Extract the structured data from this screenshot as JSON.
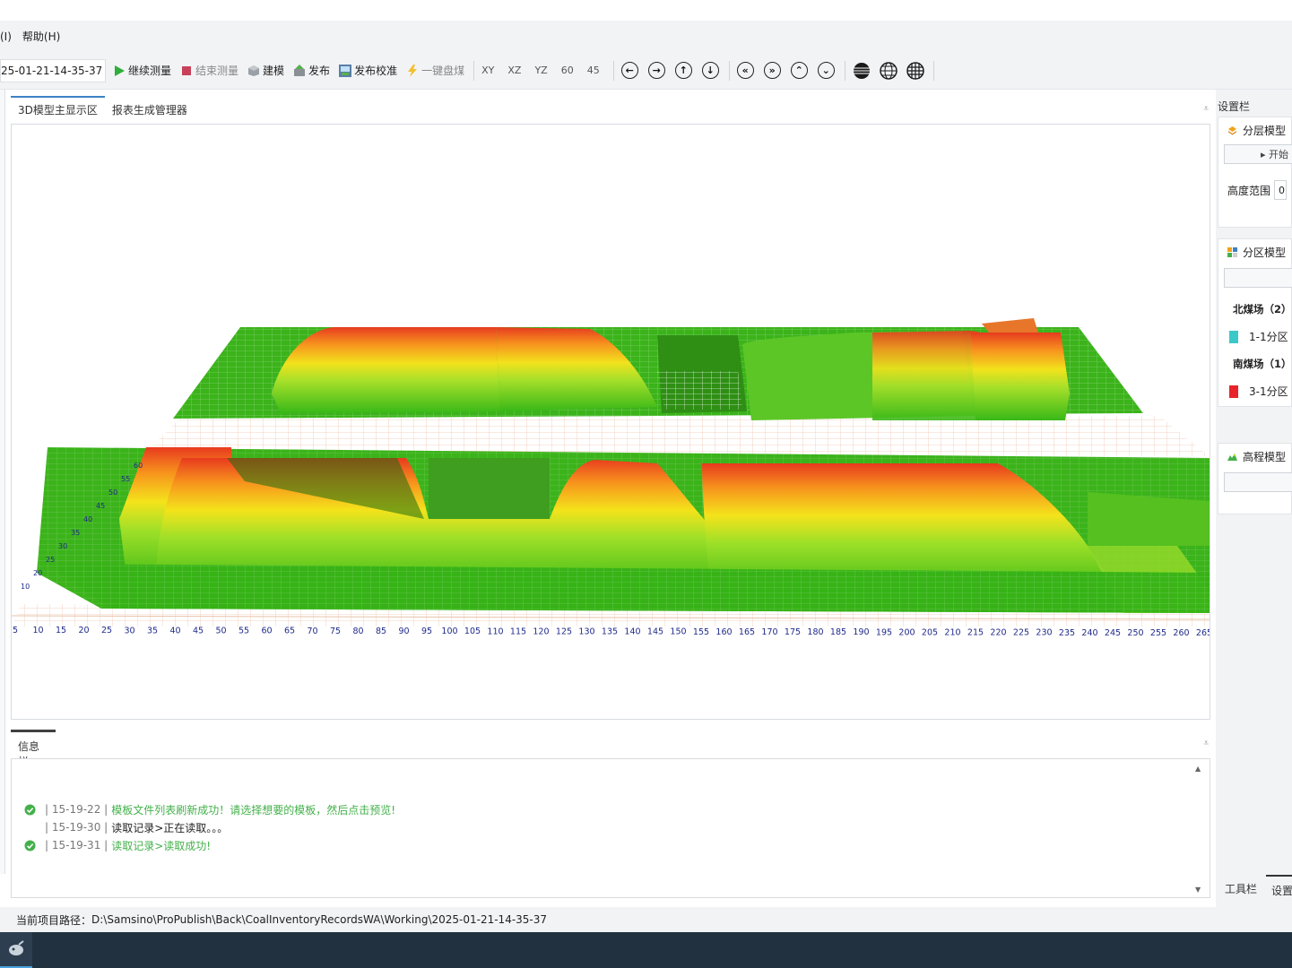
{
  "menu": {
    "items": [
      "(I)",
      "帮助(H)"
    ]
  },
  "toolbar": {
    "date_value": "25-01-21-14-35-37",
    "buttons": [
      {
        "label": "继续测量",
        "icon": "play-icon"
      },
      {
        "label": "结束测量",
        "icon": "stop-icon"
      },
      {
        "label": "建模",
        "icon": "cube-icon"
      },
      {
        "label": "发布",
        "icon": "publish-icon"
      },
      {
        "label": "发布校准",
        "icon": "publish-calibrate-icon"
      },
      {
        "label": "一键盘煤",
        "icon": "lightning-icon"
      }
    ],
    "views": [
      "XY",
      "XZ",
      "YZ",
      "60",
      "45"
    ],
    "nav_icons": [
      "arrow-left-icon",
      "arrow-right-icon",
      "arrow-up-icon",
      "arrow-down-icon",
      "double-left-icon",
      "double-right-icon",
      "double-up-icon",
      "double-down-icon"
    ],
    "render_icons": [
      "solid-globe-icon",
      "wire-globe-icon",
      "grid-globe-icon"
    ]
  },
  "main_tabs": [
    "3D模型主显示区",
    "报表生成管理器"
  ],
  "viewport": {
    "axis_ticks": [
      "5",
      "10",
      "15",
      "20",
      "25",
      "30",
      "35",
      "40",
      "45",
      "50",
      "55",
      "60",
      "65",
      "70",
      "75",
      "80",
      "85",
      "90",
      "95",
      "100",
      "105",
      "110",
      "115",
      "120",
      "125",
      "130",
      "135",
      "140",
      "145",
      "150",
      "155",
      "160",
      "165",
      "170",
      "175",
      "180",
      "185",
      "190",
      "195",
      "200",
      "205",
      "210",
      "215",
      "220",
      "225",
      "230",
      "235",
      "240",
      "245",
      "250",
      "255",
      "260",
      "265"
    ],
    "left_ticks": [
      "10",
      "20",
      "25",
      "30",
      "35",
      "40",
      "45",
      "50",
      "55",
      "60"
    ]
  },
  "info": {
    "tab_label": "信息栏",
    "logs": [
      {
        "time": "| 15-19-22 |",
        "msg": "模板文件列表刷新成功！请选择想要的模板，然后点击预览!",
        "status": "ok"
      },
      {
        "time": "| 15-19-30 |",
        "msg": "读取记录>正在读取。。。",
        "status": "plain"
      },
      {
        "time": "| 15-19-31 |",
        "msg": "读取记录>读取成功!",
        "status": "ok"
      }
    ]
  },
  "settings": {
    "title": "设置栏",
    "layer_model": {
      "title": "分层模型",
      "start_label": "▸ 开始",
      "height_range_label": "高度范围",
      "height_range_value": "0"
    },
    "zone_model": {
      "title": "分区模型",
      "groups": [
        {
          "name": "北煤场（2）",
          "zone": "1-1分区",
          "color": "#3cc8c8"
        },
        {
          "name": "南煤场（1）",
          "zone": "3-1分区",
          "color": "#e8242a"
        }
      ]
    },
    "elevation_model": {
      "title": "高程模型"
    },
    "bottom_tabs": [
      "工具栏",
      "设置"
    ]
  },
  "status": {
    "path_label": "当前项目路径：",
    "path_value": "D:\\Samsino\\ProPublish\\Back\\CoalInventoryRecordsWA\\Working\\2025-01-21-14-35-37"
  }
}
